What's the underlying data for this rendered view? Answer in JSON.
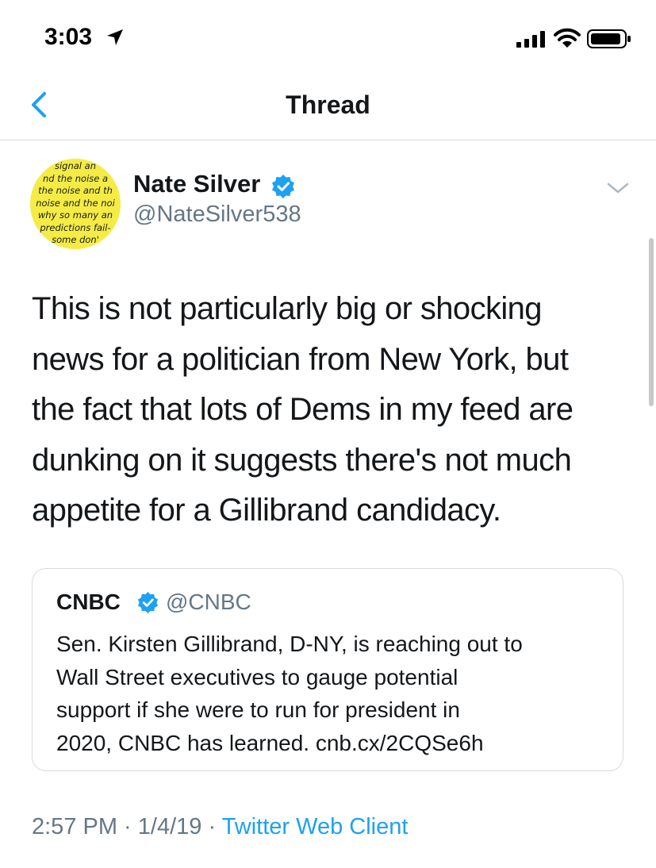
{
  "status_bar": {
    "time": "3:03",
    "icons": [
      "location-arrow-icon",
      "cellular-signal-icon",
      "wifi-icon",
      "battery-icon"
    ]
  },
  "nav": {
    "title": "Thread",
    "back_icon": "chevron-left-icon"
  },
  "author": {
    "name": "Nate Silver",
    "handle": "@NateSilver538",
    "verified": true,
    "avatar_lines": [
      "signal an",
      "nd the noise a",
      "the noise and th",
      "noise and the noi",
      "why so many an",
      "predictions fail-",
      "some don'"
    ]
  },
  "tweet": {
    "lines": [
      "This is not particularly big or shocking",
      "news for a politician from New York, but",
      "the fact that lots of Dems in my feed are",
      "dunking on it suggests there's not much",
      "appetite for a Gillibrand candidacy."
    ]
  },
  "quote": {
    "name": "CNBC",
    "handle": "@CNBC",
    "verified": true,
    "lines": [
      "Sen. Kirsten Gillibrand, D-NY, is reaching out to",
      "Wall Street executives to gauge potential",
      "support if she were to run for president in",
      "2020, CNBC has learned. cnb.cx/2CQSe6h"
    ]
  },
  "meta": {
    "time": "2:57 PM",
    "date": "1/4/19",
    "separator": " · ",
    "source": "Twitter Web Client"
  },
  "colors": {
    "accent": "#1da1f2",
    "secondary_text": "#657786",
    "primary_text": "#14171a",
    "avatar_bg": "#f4ec45"
  }
}
